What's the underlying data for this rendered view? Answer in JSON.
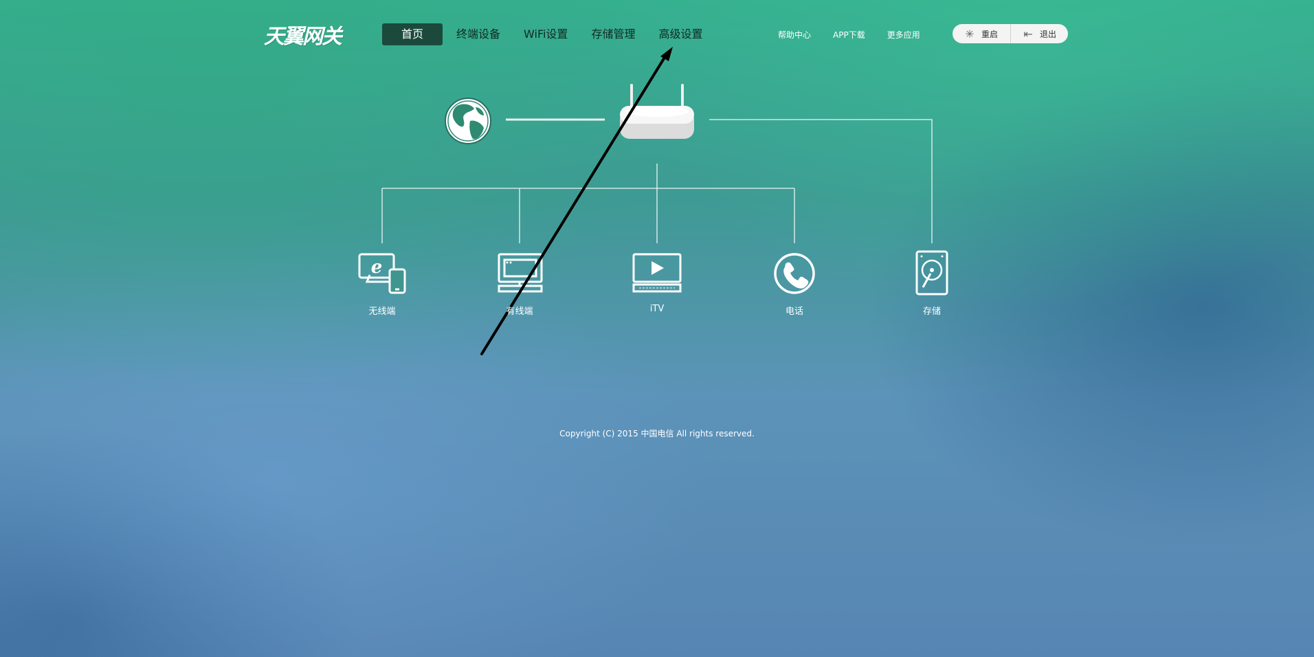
{
  "header": {
    "logo_text": "天翼网关",
    "nav": [
      "首页",
      "终端设备",
      "WiFi设置",
      "存储管理",
      "高级设置"
    ],
    "links": [
      "帮助中心",
      "APP下载",
      "更多应用"
    ],
    "actions": {
      "restart_label": "重启",
      "logout_label": "退出"
    }
  },
  "diagram": {
    "devices": [
      {
        "label": "无线端",
        "icon": "wireless-device-icon"
      },
      {
        "label": "有线端",
        "icon": "wired-computer-icon"
      },
      {
        "label": "iTV",
        "icon": "tv-icon"
      },
      {
        "label": "电话",
        "icon": "phone-icon"
      },
      {
        "label": "存储",
        "icon": "storage-icon"
      }
    ],
    "internet_icon": "globe-icon",
    "gateway_icon": "router-icon"
  },
  "footer": {
    "copyright": "Copyright (C) 2015 中国电信 All rights reserved."
  },
  "colors": {
    "nav_active_bg": "#1b4a3c",
    "line_color": "#ffffff",
    "annotation_arrow": "#000000"
  }
}
